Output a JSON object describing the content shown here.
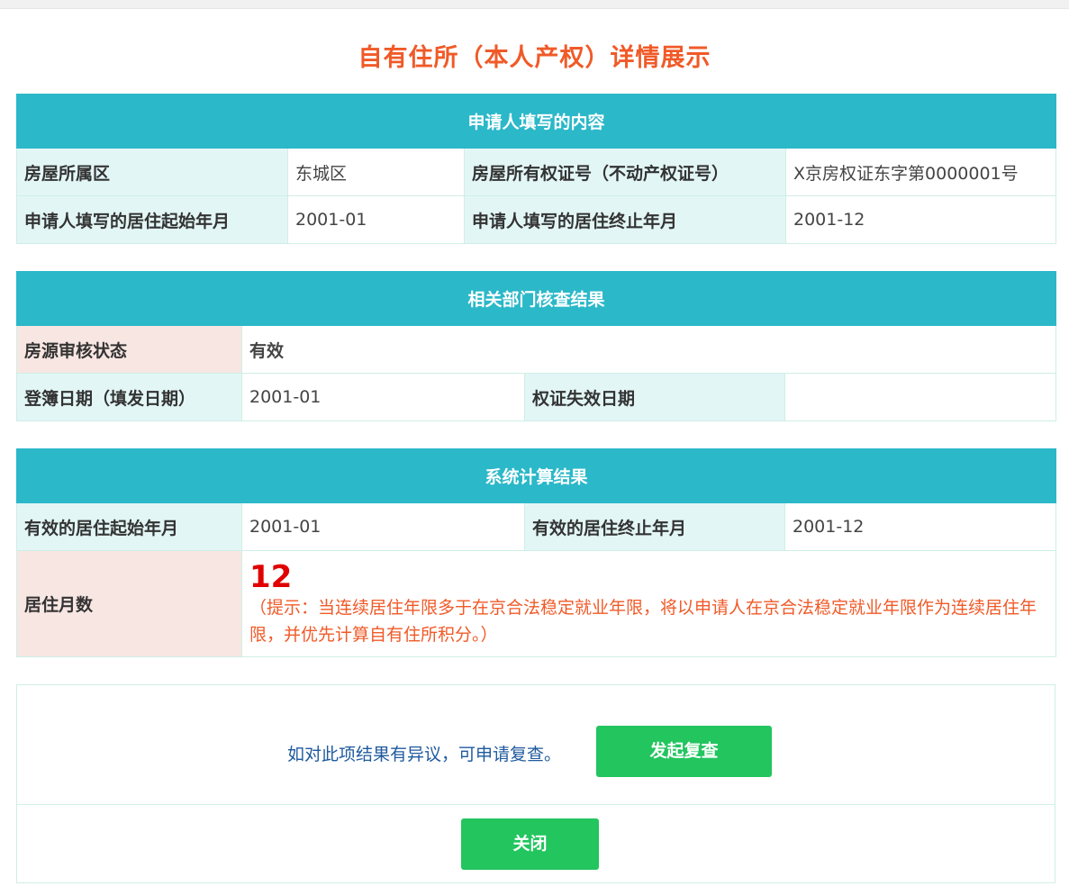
{
  "page": {
    "title": "自有住所（本人产权）详情展示"
  },
  "applicant": {
    "header": "申请人填写的内容",
    "district_label": "房屋所属区",
    "district_value": "东城区",
    "cert_label": "房屋所有权证号（不动产权证号）",
    "cert_value": "X京房权证东字第0000001号",
    "start_label": "申请人填写的居住起始年月",
    "start_value": "2001-01",
    "end_label": "申请人填写的居住终止年月",
    "end_value": "2001-12"
  },
  "verification": {
    "header": "相关部门核查结果",
    "status_label": "房源审核状态",
    "status_value": "有效",
    "register_label": "登簿日期（填发日期）",
    "register_value": "2001-01",
    "expire_label": "权证失效日期",
    "expire_value": ""
  },
  "calculation": {
    "header": "系统计算结果",
    "start_label": "有效的居住起始年月",
    "start_value": "2001-01",
    "end_label": "有效的居住终止年月",
    "end_value": "2001-12",
    "months_label": "居住月数",
    "months_value": "12",
    "hint": "（提示：当连续居住年限多于在京合法稳定就业年限，将以申请人在京合法稳定就业年限作为连续居住年限，并优先计算自有住所积分。）"
  },
  "actions": {
    "review_text": "如对此项结果有异议，可申请复查。",
    "review_button": "发起复查",
    "close_button": "关闭"
  },
  "colors": {
    "title": "#f05a28",
    "section_header": "#2bb8c9",
    "label_bg": "#e3f6f6",
    "label_pink_bg": "#f8e6e3",
    "valid_red": "#e00000",
    "hint_orange": "#f05a28",
    "button_green": "#22c55e",
    "review_text_blue": "#1f5a9e"
  }
}
